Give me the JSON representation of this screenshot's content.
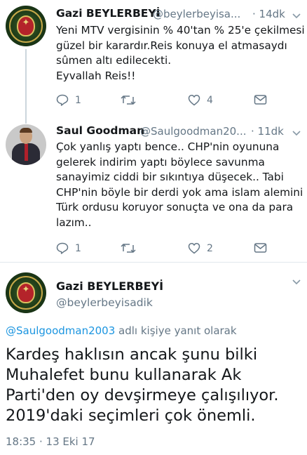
{
  "tweets": [
    {
      "display_name": "Gazi BEYLERBEYİ",
      "handle": "@beylerbeyisa...",
      "time": "· 14dk",
      "avatar": "ottoman-emblem-avatar",
      "lines": [
        "Yeni MTV vergisinin % 40'tan % 25'e çekilmesi",
        "güzel bir karardır.Reis konuya el atmasaydı",
        "sûmen altı edilecekti.",
        "Eyvallah Reis!!"
      ],
      "replies": "1",
      "retweets": "",
      "likes": "4"
    },
    {
      "display_name": "Saul Goodman",
      "handle": "@Saulgoodman20...",
      "time": "· 11dk",
      "avatar": "man-in-suit-avatar",
      "lines": [
        "Çok yanlış yaptı bence.. CHP'nin oyununa",
        "gelerek indirim yaptı böylece savunma",
        "sanayimiz ciddi bir sıkıntıya düşecek.. Tabi",
        "CHP'nin böyle bir derdi yok ama islam alemini",
        "Türk ordusu koruyor sonuçta ve ona da para",
        "lazım.."
      ],
      "replies": "1",
      "retweets": "",
      "likes": "2"
    }
  ],
  "main": {
    "display_name": "Gazi BEYLERBEYİ",
    "handle": "@beylerbeyisadik",
    "reply_mention": "@Saulgoodman2003",
    "reply_suffix": " adlı kişiye yanıt olarak",
    "lines": [
      "Kardeş haklısın ancak şunu bilki",
      "Muhalefet bunu kullanarak Ak",
      "Parti'den oy devşirmeye çalışılıyor.",
      "2019'daki seçimleri çok önemli."
    ],
    "timestamp": "18:35 · 13 Eki 17"
  },
  "colors": {
    "text": "#14171a",
    "secondary": "#657786",
    "link": "#1b95e0",
    "thread_line": "#ccd6dd",
    "divider": "#e1e8ed"
  },
  "icons": [
    "reply-icon",
    "retweet-icon",
    "like-icon",
    "message-icon",
    "chevron-down-icon"
  ]
}
